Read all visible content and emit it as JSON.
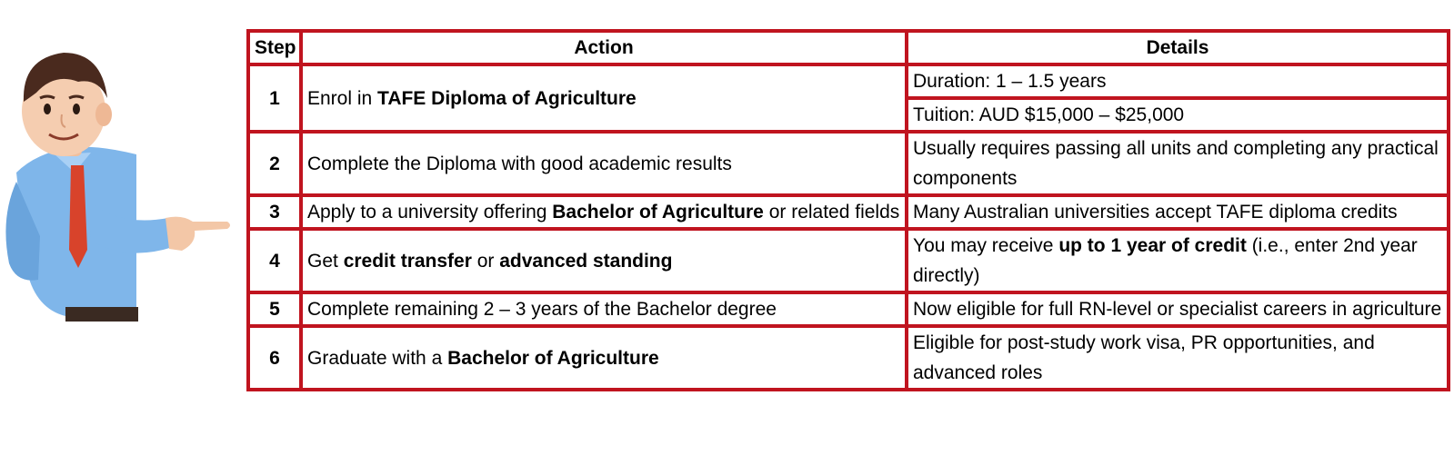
{
  "table": {
    "headers": [
      "Step",
      "Action",
      "Details"
    ],
    "rows": [
      {
        "step": "1",
        "action": [
          {
            "t": "Enrol in "
          },
          {
            "t": "TAFE Diploma of Agriculture",
            "b": true
          }
        ],
        "details": [
          [
            {
              "t": "Duration: 1 – 1.5 years"
            }
          ],
          [
            {
              "t": "Tuition: AUD $15,000 – $25,000"
            }
          ]
        ]
      },
      {
        "step": "2",
        "action": [
          {
            "t": "Complete the Diploma with good academic results"
          }
        ],
        "details": [
          [
            {
              "t": "Usually requires passing all units and completing any practical components"
            }
          ]
        ]
      },
      {
        "step": "3",
        "action": [
          {
            "t": "Apply to a university offering "
          },
          {
            "t": "Bachelor of Agriculture",
            "b": true
          },
          {
            "t": " or related fields"
          }
        ],
        "details": [
          [
            {
              "t": "Many Australian universities accept TAFE diploma credits"
            }
          ]
        ]
      },
      {
        "step": "4",
        "action": [
          {
            "t": "Get "
          },
          {
            "t": "credit transfer",
            "b": true
          },
          {
            "t": " or "
          },
          {
            "t": "advanced standing",
            "b": true
          }
        ],
        "details": [
          [
            {
              "t": "You may receive "
            },
            {
              "t": "up to 1 year of credit",
              "b": true
            },
            {
              "t": " (i.e., enter 2nd year directly)"
            }
          ]
        ]
      },
      {
        "step": "5",
        "action": [
          {
            "t": "Complete remaining 2 – 3 years of the Bachelor degree"
          }
        ],
        "details": [
          [
            {
              "t": "Now eligible for full RN-level or specialist careers in agriculture"
            }
          ]
        ]
      },
      {
        "step": "6",
        "action": [
          {
            "t": "Graduate with a "
          },
          {
            "t": "Bachelor of Agriculture",
            "b": true
          }
        ],
        "details": [
          [
            {
              "t": "Eligible for post-study work visa, PR opportunities, and advanced roles"
            }
          ]
        ]
      }
    ]
  },
  "colors": {
    "border": "#c0141f",
    "shirt": "#7fb6ea",
    "tie": "#d8432b"
  }
}
